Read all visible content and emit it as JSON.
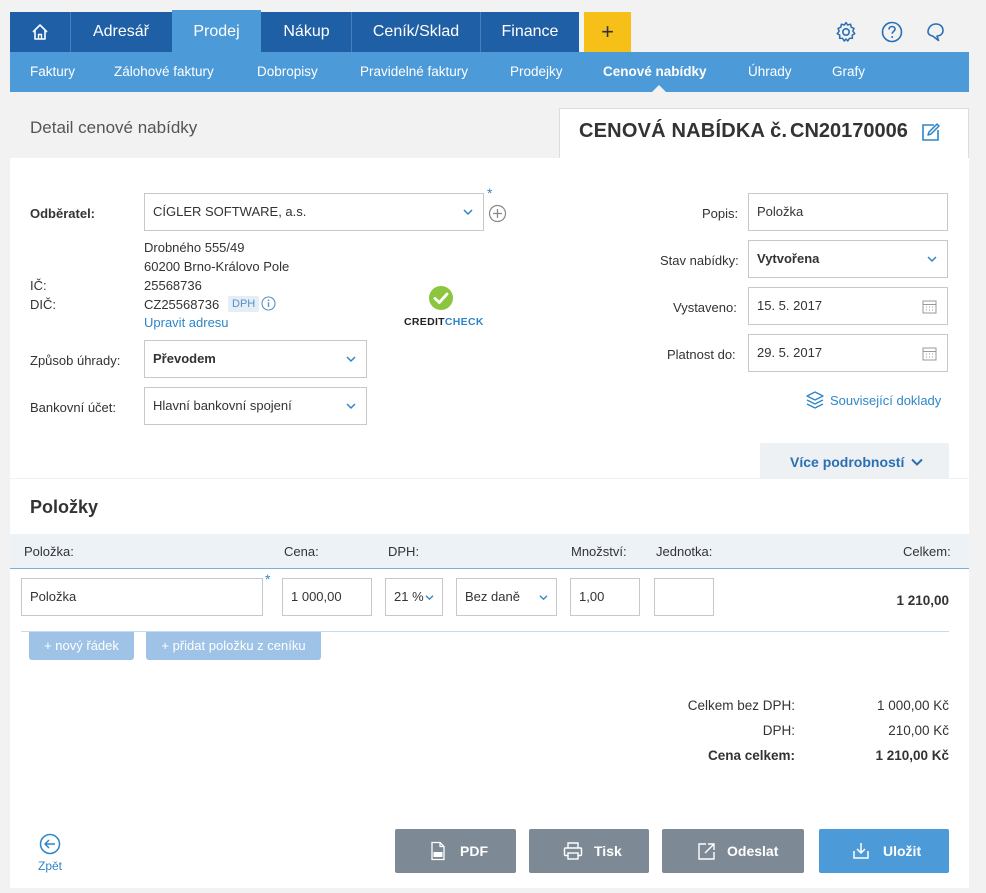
{
  "topnav": {
    "tabs": [
      {
        "label": "Adresář"
      },
      {
        "label": "Prodej"
      },
      {
        "label": "Nákup"
      },
      {
        "label": "Ceník/Sklad"
      },
      {
        "label": "Finance"
      }
    ],
    "plus_label": "+"
  },
  "subnav": {
    "items": [
      {
        "label": "Faktury"
      },
      {
        "label": "Zálohové faktury"
      },
      {
        "label": "Dobropisy"
      },
      {
        "label": "Pravidelné faktury"
      },
      {
        "label": "Prodejky"
      },
      {
        "label": "Cenové nabídky"
      },
      {
        "label": "Úhrady"
      },
      {
        "label": "Grafy"
      }
    ]
  },
  "header": {
    "page_title": "Detail cenové nabídky",
    "doc_title": "CENOVÁ NABÍDKA č.",
    "doc_number": "CN20170006"
  },
  "customer": {
    "label": "Odběratel:",
    "value": "CÍGLER SOFTWARE, a.s.",
    "asterisk": "*",
    "street": "Drobného 555/49",
    "city": "60200 Brno-Královo Pole",
    "ic_label": "IČ:",
    "ic_value": "25568736",
    "dic_label": "DIČ:",
    "dic_value": "CZ25568736",
    "dph_badge": "DPH",
    "edit_address": "Upravit adresu",
    "creditcheck_a": "CREDIT",
    "creditcheck_b": "CHECK"
  },
  "payment": {
    "method_label": "Způsob úhrady:",
    "method_value": "Převodem",
    "account_label": "Bankovní účet:",
    "account_value": "Hlavní bankovní spojení"
  },
  "right": {
    "popis_label": "Popis:",
    "popis_value": "Položka",
    "stav_label": "Stav nabídky:",
    "stav_value": "Vytvořena",
    "vystaveno_label": "Vystaveno:",
    "vystaveno_value": "15. 5. 2017",
    "platnost_label": "Platnost do:",
    "platnost_value": "29. 5. 2017",
    "related": "Související doklady",
    "more": "Více podrobností"
  },
  "items": {
    "title": "Položky",
    "headers": {
      "item": "Položka:",
      "price": "Cena:",
      "vat": "DPH:",
      "qty": "Množství:",
      "unit": "Jednotka:",
      "total": "Celkem:"
    },
    "row": {
      "item": "Položka",
      "asterisk": "*",
      "price": "1 000,00",
      "vat": "21 %",
      "vat_type": "Bez daně",
      "qty": "1,00",
      "unit": "",
      "total": "1 210,00"
    },
    "new_row": "+ nový řádek",
    "add_from_pricelist": "+ přidat položku z ceníku"
  },
  "totals": {
    "without_vat_label": "Celkem bez DPH:",
    "without_vat_value": "1 000,00 Kč",
    "vat_label": "DPH:",
    "vat_value": "210,00 Kč",
    "total_label": "Cena celkem:",
    "total_value": "1 210,00 Kč"
  },
  "footer": {
    "back": "Zpět",
    "pdf": "PDF",
    "print": "Tisk",
    "send": "Odeslat",
    "save": "Uložit"
  },
  "colors": {
    "nav_dark": "#1f5fa6",
    "nav_light": "#4d9ad9",
    "plus": "#f6c018",
    "btn_grey": "#7d8a96",
    "link": "#2e86c8",
    "check": "#8cc63f"
  }
}
